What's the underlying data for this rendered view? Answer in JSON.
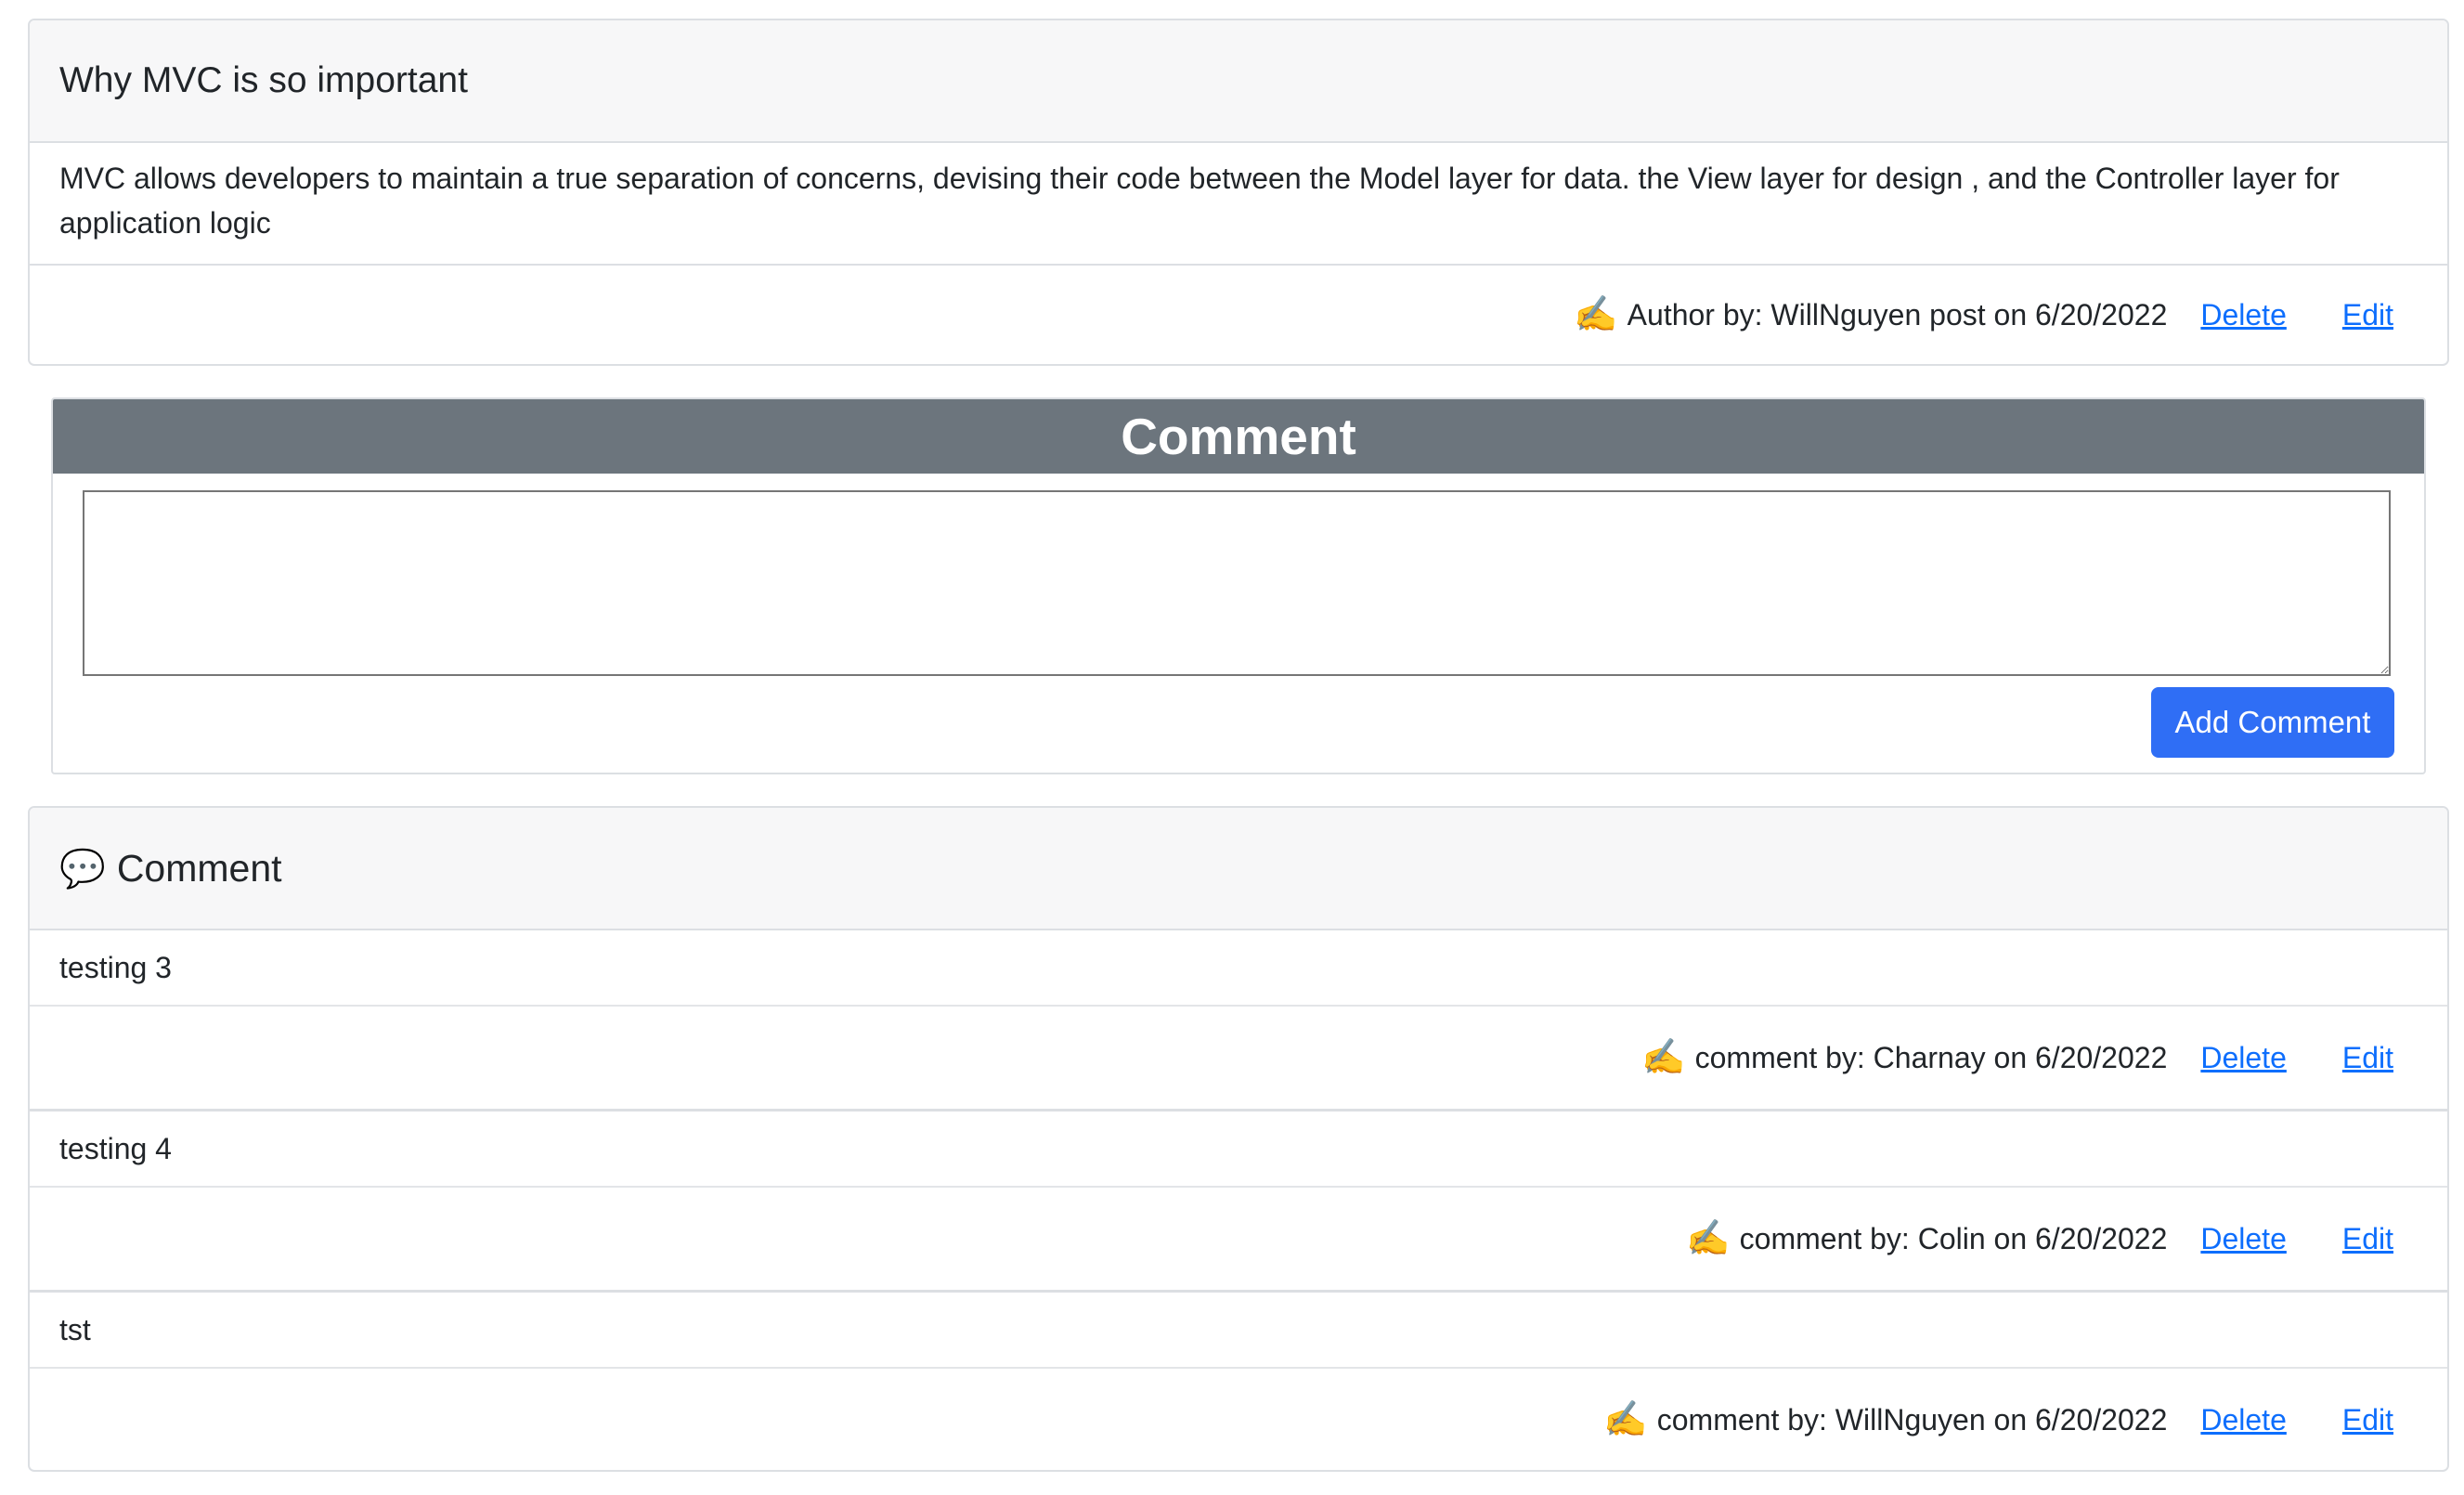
{
  "post": {
    "title": "Why MVC is so important",
    "body": "MVC allows developers to maintain a true separation of concerns, devising their code between the Model layer for data. the View layer for design , and the Controller layer for application logic",
    "meta_emoji": "✍️",
    "meta": "Author by: WillNguyen post on 6/20/2022",
    "delete_label": "Delete",
    "edit_label": "Edit"
  },
  "comment_form": {
    "title": "Comment",
    "textarea_value": "",
    "submit_label": "Add Comment"
  },
  "comments_section": {
    "icon": "💬",
    "title": "Comment",
    "items": [
      {
        "text": "testing 3",
        "emoji": "✍️",
        "meta": "comment by: Charnay on 6/20/2022",
        "delete_label": "Delete",
        "edit_label": "Edit"
      },
      {
        "text": "testing 4",
        "emoji": "✍️",
        "meta": "comment by: Colin on 6/20/2022",
        "delete_label": "Delete",
        "edit_label": "Edit"
      },
      {
        "text": "tst",
        "emoji": "✍️",
        "meta": "comment by: WillNguyen on 6/20/2022",
        "delete_label": "Delete",
        "edit_label": "Edit"
      }
    ]
  },
  "colors": {
    "link": "#0d6efd",
    "button": "#2f6ef5",
    "form_header": "#6c757d",
    "card_header": "#f7f7f8"
  }
}
